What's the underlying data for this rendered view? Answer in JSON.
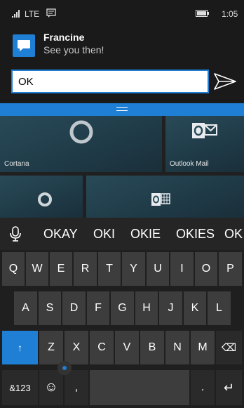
{
  "status_bar": {
    "network": "LTE",
    "time": "1:05"
  },
  "notification": {
    "sender": "Francine",
    "message": "See you then!"
  },
  "reply": {
    "value": "OK"
  },
  "tiles": {
    "cortana_label": "Cortana",
    "outlook_label": "Outlook Mail"
  },
  "suggestions": [
    "OKAY",
    "OKI",
    "OKIE",
    "OKIES",
    "OK"
  ],
  "keyboard": {
    "row1": [
      "Q",
      "W",
      "E",
      "R",
      "T",
      "Y",
      "U",
      "I",
      "O",
      "P"
    ],
    "row2": [
      "A",
      "S",
      "D",
      "F",
      "G",
      "H",
      "J",
      "K",
      "L"
    ],
    "row3": [
      "Z",
      "X",
      "C",
      "V",
      "B",
      "N",
      "M"
    ],
    "shift_glyph": "↑",
    "backspace_glyph": "⌫",
    "symbols_label": "&123",
    "emoji_glyph": "☺",
    "comma_label": ",",
    "period_label": ".",
    "enter_glyph": "↵"
  },
  "colors": {
    "accent": "#1e7fd4",
    "background": "#1a1a1a",
    "key": "#3d3d3d"
  }
}
